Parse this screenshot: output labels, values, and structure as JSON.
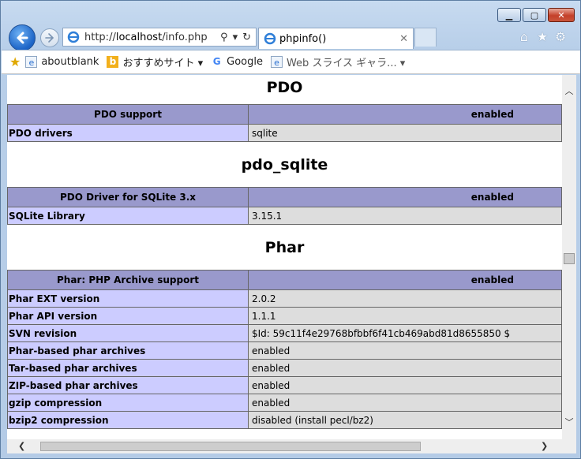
{
  "window": {
    "minimize": "▁",
    "maximize": "▢",
    "close": "✕"
  },
  "nav": {
    "url_prefix": "http://",
    "url_host": "localhost",
    "url_path": "/info.php",
    "tab_title": "phpinfo()"
  },
  "favorites": [
    {
      "label": "aboutblank",
      "icon": "page-icon"
    },
    {
      "label": "おすすめサイト ▾",
      "icon": "bing-icon"
    },
    {
      "label": "Google",
      "icon": "google-icon"
    },
    {
      "label": "Web スライス ギャラ... ▾",
      "icon": "page-icon"
    }
  ],
  "sections": [
    {
      "title": "PDO",
      "header": {
        "key": "PDO support",
        "value": "enabled"
      },
      "rows": [
        {
          "key": "PDO drivers",
          "value": "sqlite"
        }
      ]
    },
    {
      "title": "pdo_sqlite",
      "header": {
        "key": "PDO Driver for SQLite 3.x",
        "value": "enabled"
      },
      "rows": [
        {
          "key": "SQLite Library",
          "value": "3.15.1"
        }
      ]
    },
    {
      "title": "Phar",
      "header": {
        "key": "Phar: PHP Archive support",
        "value": "enabled"
      },
      "rows": [
        {
          "key": "Phar EXT version",
          "value": "2.0.2"
        },
        {
          "key": "Phar API version",
          "value": "1.1.1"
        },
        {
          "key": "SVN revision",
          "value": "$Id: 59c11f4e29768bfbbf6f41cb469abd81d8655850 $"
        },
        {
          "key": "Phar-based phar archives",
          "value": "enabled"
        },
        {
          "key": "Tar-based phar archives",
          "value": "enabled"
        },
        {
          "key": "ZIP-based phar archives",
          "value": "enabled"
        },
        {
          "key": "gzip compression",
          "value": "enabled"
        },
        {
          "key": "bzip2 compression",
          "value": "disabled (install pecl/bz2)"
        }
      ]
    }
  ]
}
